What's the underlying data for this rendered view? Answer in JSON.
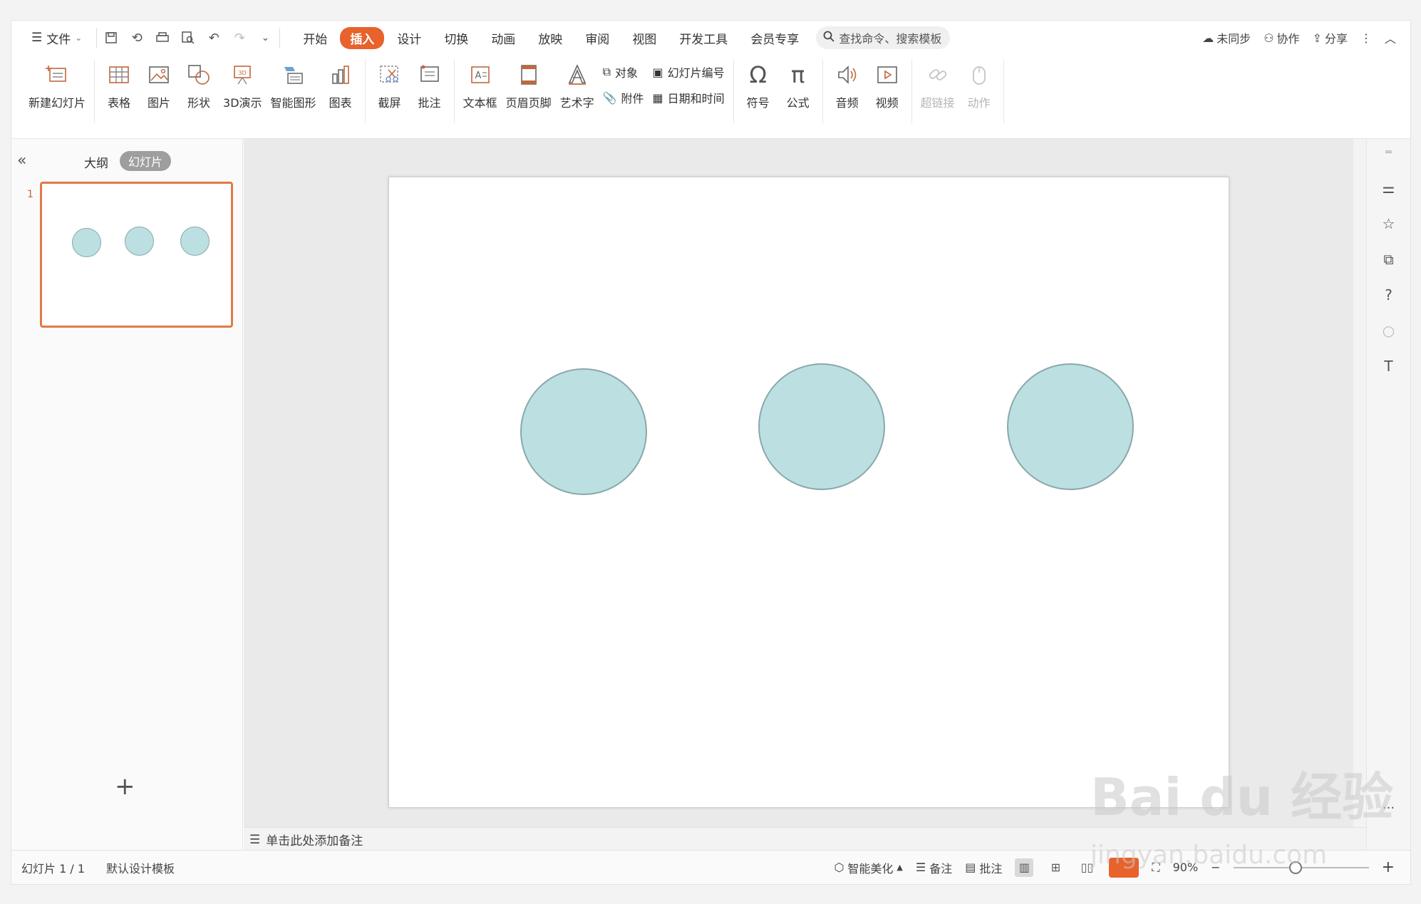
{
  "menu": {
    "file_label": "文件",
    "tabs": [
      {
        "label": "开始",
        "active": false
      },
      {
        "label": "插入",
        "active": true
      },
      {
        "label": "设计",
        "active": false
      },
      {
        "label": "切换",
        "active": false
      },
      {
        "label": "动画",
        "active": false
      },
      {
        "label": "放映",
        "active": false
      },
      {
        "label": "审阅",
        "active": false
      },
      {
        "label": "视图",
        "active": false
      },
      {
        "label": "开发工具",
        "active": false
      },
      {
        "label": "会员专享",
        "active": false
      }
    ],
    "search_text": "查找命令、搜索模板",
    "sync_label": "未同步",
    "collab_label": "协作",
    "share_label": "分享"
  },
  "ribbon": {
    "new_slide": "新建幻灯片",
    "table": "表格",
    "picture": "图片",
    "shape": "形状",
    "demo3d": "3D演示",
    "smartart": "智能图形",
    "chart": "图表",
    "screenshot": "截屏",
    "comment": "批注",
    "textbox": "文本框",
    "header_footer": "页眉页脚",
    "wordart": "艺术字",
    "object": "对象",
    "attachment": "附件",
    "slide_number": "幻灯片编号",
    "datetime": "日期和时间",
    "symbol": "符号",
    "formula": "公式",
    "audio": "音频",
    "video": "视频",
    "hyperlink": "超链接",
    "action": "动作"
  },
  "leftpanel": {
    "tab_outline": "大纲",
    "tab_slides": "幻灯片",
    "slide_number": "1"
  },
  "notes_placeholder": "单击此处添加备注",
  "status": {
    "slide_info": "幻灯片 1 / 1",
    "template": "默认设计模板",
    "beautify": "智能美化",
    "notes": "备注",
    "comment": "批注",
    "zoom": "90%"
  },
  "watermark": {
    "main": "Bai du 经验",
    "url": "jingyan.baidu.com"
  },
  "colors": {
    "accent": "#e8622c",
    "circle_fill": "#bcdfe2",
    "circle_stroke": "#8aa8ab"
  }
}
